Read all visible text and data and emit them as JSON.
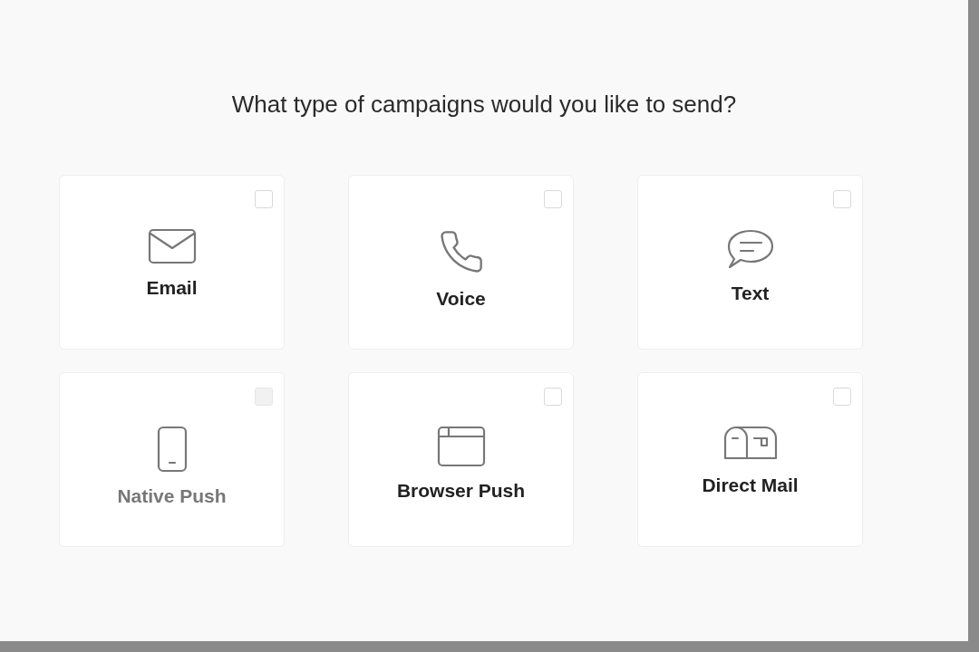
{
  "title": "What type of campaigns would you like to send?",
  "options": [
    {
      "label": "Email",
      "kind": "email",
      "checked": false,
      "disabled": false
    },
    {
      "label": "Voice",
      "kind": "phone",
      "checked": false,
      "disabled": false
    },
    {
      "label": "Text",
      "kind": "chat",
      "checked": false,
      "disabled": false
    },
    {
      "label": "Native Push",
      "kind": "mobile",
      "checked": false,
      "disabled": true
    },
    {
      "label": "Browser Push",
      "kind": "browser",
      "checked": false,
      "disabled": false
    },
    {
      "label": "Direct Mail",
      "kind": "mailbox",
      "checked": false,
      "disabled": false
    }
  ]
}
